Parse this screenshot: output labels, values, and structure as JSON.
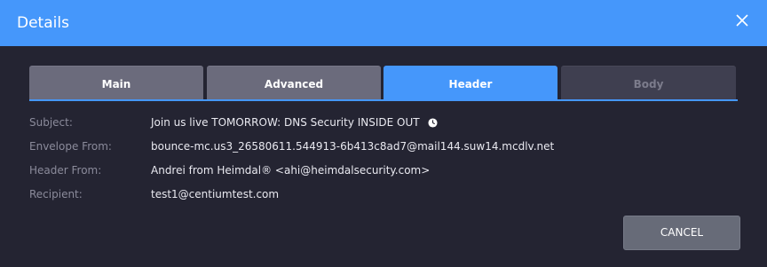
{
  "dialog": {
    "title": "Details",
    "close_icon": "close-icon"
  },
  "tabs": [
    {
      "label": "Main",
      "state": "normal"
    },
    {
      "label": "Advanced",
      "state": "normal"
    },
    {
      "label": "Header",
      "state": "active"
    },
    {
      "label": "Body",
      "state": "disabled"
    }
  ],
  "fields": {
    "subject": {
      "label": "Subject:",
      "value": "Join us live TOMORROW: DNS Security INSIDE OUT",
      "trailing_icon": "clock-icon"
    },
    "envelope_from": {
      "label": "Envelope From:",
      "value": "bounce-mc.us3_26580611.544913-6b413c8ad7@mail144.suw14.mcdlv.net"
    },
    "header_from": {
      "label": "Header From:",
      "value": "Andrei from Heimdal® <ahi@heimdalsecurity.com>"
    },
    "recipient": {
      "label": "Recipient:",
      "value": "test1@centiumtest.com"
    }
  },
  "actions": {
    "cancel_label": "CANCEL"
  },
  "colors": {
    "accent": "#4597fb",
    "background": "#242432",
    "tab_inactive": "#6b6b7c",
    "tab_disabled": "#3f3f50",
    "button": "#676b78"
  }
}
